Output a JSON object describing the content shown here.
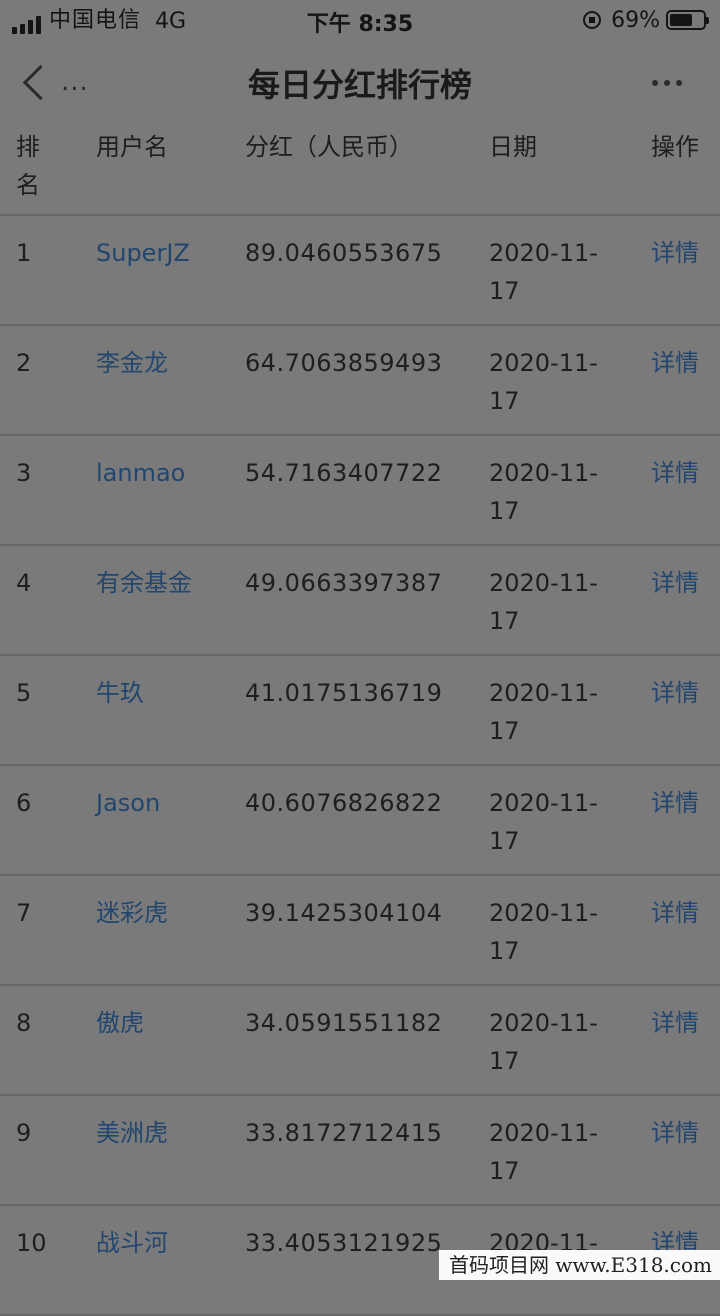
{
  "status_bar": {
    "carrier": "中国电信",
    "network": "4G",
    "time": "下午 8:35",
    "battery": "69%",
    "battery_level": 0.69
  },
  "nav": {
    "back_dots": "...",
    "title": "每日分红排行榜"
  },
  "table": {
    "headers": {
      "rank": "排名",
      "user": "用户名",
      "amount": "分红（人民币）",
      "date": "日期",
      "action": "操作"
    },
    "rows": [
      {
        "rank": "1",
        "user": "SuperJZ",
        "amount": "89.0460553675",
        "date_line1": "2020-11-",
        "date_line2": "17",
        "action": "详情"
      },
      {
        "rank": "2",
        "user": "李金龙",
        "amount": "64.7063859493",
        "date_line1": "2020-11-",
        "date_line2": "17",
        "action": "详情"
      },
      {
        "rank": "3",
        "user": "lanmao",
        "amount": "54.7163407722",
        "date_line1": "2020-11-",
        "date_line2": "17",
        "action": "详情"
      },
      {
        "rank": "4",
        "user": "有余基金",
        "amount": "49.0663397387",
        "date_line1": "2020-11-",
        "date_line2": "17",
        "action": "详情"
      },
      {
        "rank": "5",
        "user": "牛玖",
        "amount": "41.0175136719",
        "date_line1": "2020-11-",
        "date_line2": "17",
        "action": "详情"
      },
      {
        "rank": "6",
        "user": "Jason",
        "amount": "40.6076826822",
        "date_line1": "2020-11-",
        "date_line2": "17",
        "action": "详情"
      },
      {
        "rank": "7",
        "user": "迷彩虎",
        "amount": "39.1425304104",
        "date_line1": "2020-11-",
        "date_line2": "17",
        "action": "详情"
      },
      {
        "rank": "8",
        "user": "傲虎",
        "amount": "34.0591551182",
        "date_line1": "2020-11-",
        "date_line2": "17",
        "action": "详情"
      },
      {
        "rank": "9",
        "user": "美洲虎",
        "amount": "33.8172712415",
        "date_line1": "2020-11-",
        "date_line2": "17",
        "action": "详情"
      },
      {
        "rank": "10",
        "user": "战斗河",
        "amount": "33.4053121925",
        "date_line1": "2020-11-",
        "date_line2": "",
        "action": "详情"
      }
    ]
  },
  "watermark": "首码项目网 www.E318.com",
  "colors": {
    "background": "#7a7a7a",
    "link": "#22466e",
    "text": "#1e1e1e"
  }
}
